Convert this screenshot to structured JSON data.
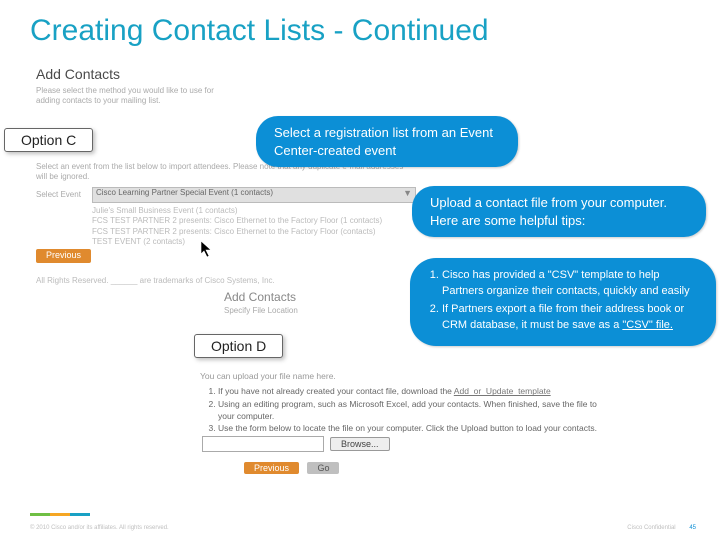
{
  "title": "Creating Contact Lists - Continued",
  "section": {
    "heading": "Add Contacts",
    "note": "Please select the method you would like to use for adding contacts to your mailing list."
  },
  "tabs": {
    "c": "Option C",
    "d": "Option D"
  },
  "pills": {
    "p1": "Select a registration list from an Event Center-created event",
    "p2": "Upload a contact file from your computer. Here are some helpful tips:",
    "p3": {
      "li1": "Cisco has provided a \"CSV\" template to help Partners organize their contacts, quickly and easily",
      "li2_a": "If Partners export a file from their address book or CRM database, it must be save as a ",
      "li2_b": "\"CSV\" file."
    }
  },
  "event_select": {
    "intro": "Select an event from the list below to import attendees. Please note that any duplicate e-mail addresses will be ignored.",
    "label": "Select Event",
    "rows": [
      "Cisco Learning Partner Special Event  (1 contacts)",
      "Julie's Small Business Event  (1 contacts)",
      "FCS TEST PARTNER 2 presents: Cisco Ethernet to the Factory Floor  (1 contacts)",
      "FCS TEST PARTNER 2 presents: Cisco Ethernet to the Factory Floor  (contacts)",
      "TEST EVENT  (2 contacts)"
    ],
    "prev": "Previous"
  },
  "rights_text": "All Rights Reserved. ______ are trademarks of Cisco Systems, Inc.",
  "add2": {
    "heading": "Add Contacts",
    "sub": "Specify File Location"
  },
  "file_block": {
    "lead": "You can upload your file name here.",
    "li1_a": "If you have not already created your contact file, download the ",
    "li1_b": "Add_or_Update_template",
    "li2": "Using an editing program, such as Microsoft Excel, add your contacts. When finished, save the file to your computer.",
    "li3": "Use the form below to locate the file on your computer. Click the Upload button to load your contacts."
  },
  "browse": {
    "btn": "Browse..."
  },
  "bottom": {
    "prev": "Previous",
    "go": "Go"
  },
  "footer": {
    "left": "© 2010 Cisco and/or its affiliates. All rights reserved.",
    "right": "Cisco Confidential",
    "page": "45"
  }
}
